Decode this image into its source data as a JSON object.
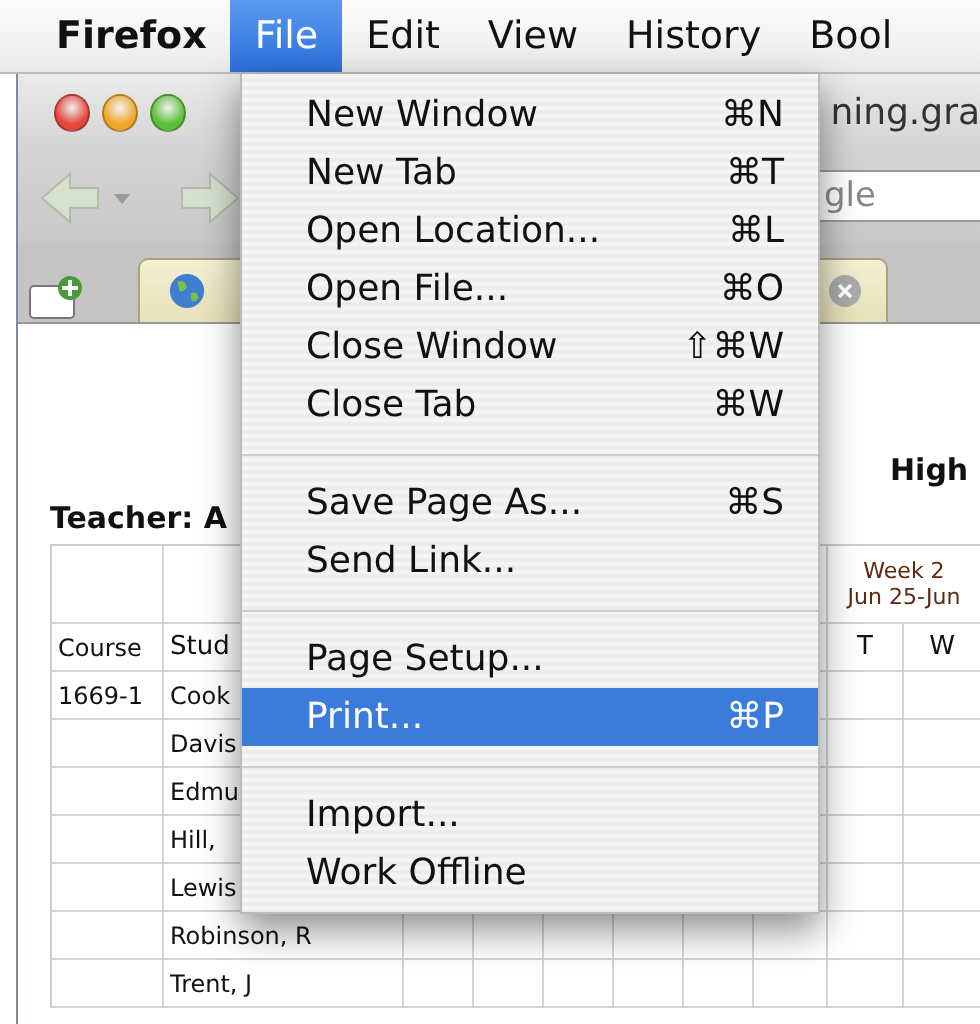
{
  "menu_bar": {
    "items": [
      {
        "label": "Firefox",
        "selected": false,
        "kind": "app"
      },
      {
        "label": "File",
        "selected": true,
        "kind": "menu"
      },
      {
        "label": "Edit",
        "selected": false,
        "kind": "menu"
      },
      {
        "label": "View",
        "selected": false,
        "kind": "menu"
      },
      {
        "label": "History",
        "selected": false,
        "kind": "menu"
      },
      {
        "label": "Bool",
        "selected": false,
        "kind": "menu"
      }
    ]
  },
  "browser": {
    "title": "ning.gra",
    "search": {
      "value": "gle"
    },
    "page": {
      "heading": "High",
      "teacher": "Teacher: A",
      "table": {
        "week_label": "Week 2",
        "week_dates": "Jun 25-Jun",
        "course_header": "Course",
        "student_header": "Stud",
        "day_headers": [
          "T",
          "W"
        ],
        "rows": [
          {
            "course": "1669-1",
            "student": "Cook"
          },
          {
            "student": "Davis"
          },
          {
            "student": "Edmu"
          },
          {
            "student": "Hill,"
          },
          {
            "student": "Lewis"
          },
          {
            "student": "Robinson, R"
          },
          {
            "student": "Trent, J"
          }
        ]
      }
    }
  },
  "file_menu": {
    "items": [
      {
        "kind": "item",
        "label": "New Window",
        "shortcut": "⌘N",
        "selected": false
      },
      {
        "kind": "item",
        "label": "New Tab",
        "shortcut": "⌘T",
        "selected": false
      },
      {
        "kind": "item",
        "label": "Open Location...",
        "shortcut": "⌘L",
        "selected": false
      },
      {
        "kind": "item",
        "label": "Open File...",
        "shortcut": "⌘O",
        "selected": false
      },
      {
        "kind": "item",
        "label": "Close Window",
        "shortcut": "⇧⌘W",
        "selected": false
      },
      {
        "kind": "item",
        "label": "Close Tab",
        "shortcut": "⌘W",
        "selected": false
      },
      {
        "kind": "separator"
      },
      {
        "kind": "item",
        "label": "Save Page As...",
        "shortcut": "⌘S",
        "selected": false
      },
      {
        "kind": "item",
        "label": "Send Link...",
        "selected": false
      },
      {
        "kind": "separator"
      },
      {
        "kind": "item",
        "label": "Page Setup...",
        "selected": false
      },
      {
        "kind": "item",
        "label": "Print...",
        "shortcut": "⌘P",
        "selected": true
      },
      {
        "kind": "separator"
      },
      {
        "kind": "item",
        "label": "Import...",
        "selected": false
      },
      {
        "kind": "item",
        "label": "Work Offline",
        "selected": false
      }
    ]
  }
}
